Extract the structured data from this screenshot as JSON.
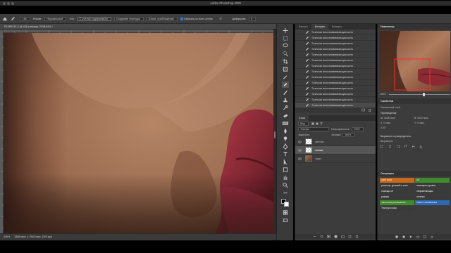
{
  "app": {
    "window_title": "Adobe Photoshop 2020"
  },
  "options_bar": {
    "mode_label": "Режим:",
    "mode_value": "Нормальный",
    "source_label": "Тип:",
    "source_value": "С учетом содержимого",
    "create_texture": "Создание текстуры",
    "proximity": "Близк. приближение",
    "sample_all_layers": "Образец со всех слоев",
    "angle_value": "0°",
    "diffusion_label": "Диффузия:",
    "diffusion_value": "5"
  },
  "document": {
    "tab_title": "P1099133-3 @ 436 (темная, RGB/16*) *",
    "status_zoom": "436%",
    "status_info": "3888 пикс. x 2592 пикс. (300 ppi)"
  },
  "history_panel": {
    "tabs": [
      "Каналы",
      "История",
      "Контуры"
    ],
    "active_tab": "История",
    "item_label": "Точечная восстанавливающая кисть",
    "item_count": 14
  },
  "layers_panel": {
    "title": "Слои",
    "filter_label": "Вид",
    "blend_mode": "Темная",
    "opacity_label": "Непрозрачность:",
    "opacity_value": "100%",
    "lock_label": "Закрепить:",
    "fill_label": "Заливка:",
    "fill_value": "100%",
    "layers": [
      {
        "name": "светлая"
      },
      {
        "name": "темная"
      },
      {
        "name": "подкл."
      }
    ]
  },
  "navigator": {
    "title": "Навигатор",
    "zoom": "436%"
  },
  "properties": {
    "title": "Свойства",
    "kind": "Пиксельный слой",
    "transform_title": "Перемещение",
    "w": "Ш: 3428 пикс.",
    "h": "В: 3643 пикс.",
    "x": "X: 0 пикс.",
    "y": "Y: 0 пикс.",
    "angle": "0,00°",
    "align_title": "Выровнять и распределить",
    "align_sub": "Выровнять:"
  },
  "actions": {
    "title": "Операции",
    "items": [
      {
        "label": "цвет кожи",
        "color": "#c96a1a"
      },
      {
        "label": "об",
        "color": "#3f8a2a"
      },
      {
        "label": "ремонтр. уровней и спек.",
        "color": "#3a3a3a"
      },
      {
        "label": "помощник уровня",
        "color": "#3a3a3a"
      },
      {
        "label": "помощь об",
        "color": "#3a3a3a"
      },
      {
        "label": "направляющая",
        "color": "#3a3a3a"
      },
      {
        "label": "размер",
        "color": "#3a3a3a"
      },
      {
        "label": "оттенок",
        "color": "#3a3a3a"
      },
      {
        "label": "частотное разложение",
        "color": "#3f8a2a"
      },
      {
        "label": "осветл затемнение",
        "color": "#2d6ab5"
      },
      {
        "label": "Текстура кожи",
        "color": "#3a3a3a"
      }
    ]
  },
  "colors": {
    "accent": "#2d7be5",
    "panel_bg": "#3c3c3c",
    "skin_light": "#a8775a",
    "lip": "#8a2a33"
  }
}
